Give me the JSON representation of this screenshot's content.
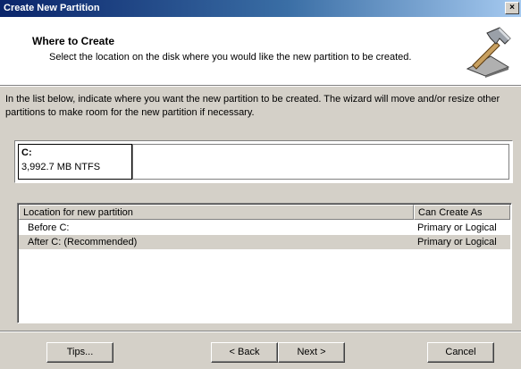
{
  "window": {
    "title": "Create New Partition",
    "close_glyph": "×"
  },
  "header": {
    "title": "Where to Create",
    "description": "Select the location on the disk where you would like the new partition to be created.",
    "icon": "hammer-icon"
  },
  "intro": "In the list below, indicate where you want the new partition to be created. The wizard will move and/or resize other partitions to make room for the new partition if necessary.",
  "disk": {
    "partition_name": "C:",
    "partition_info": "3,992.7 MB   NTFS"
  },
  "list": {
    "columns": [
      "Location for new partition",
      "Can Create As"
    ],
    "rows": [
      {
        "location": "Before C:",
        "type": "Primary or Logical",
        "selected": false
      },
      {
        "location": "After C:   (Recommended)",
        "type": "Primary or Logical",
        "selected": true
      }
    ]
  },
  "buttons": {
    "tips": "Tips...",
    "back": "< Back",
    "next": "Next >",
    "cancel": "Cancel"
  }
}
